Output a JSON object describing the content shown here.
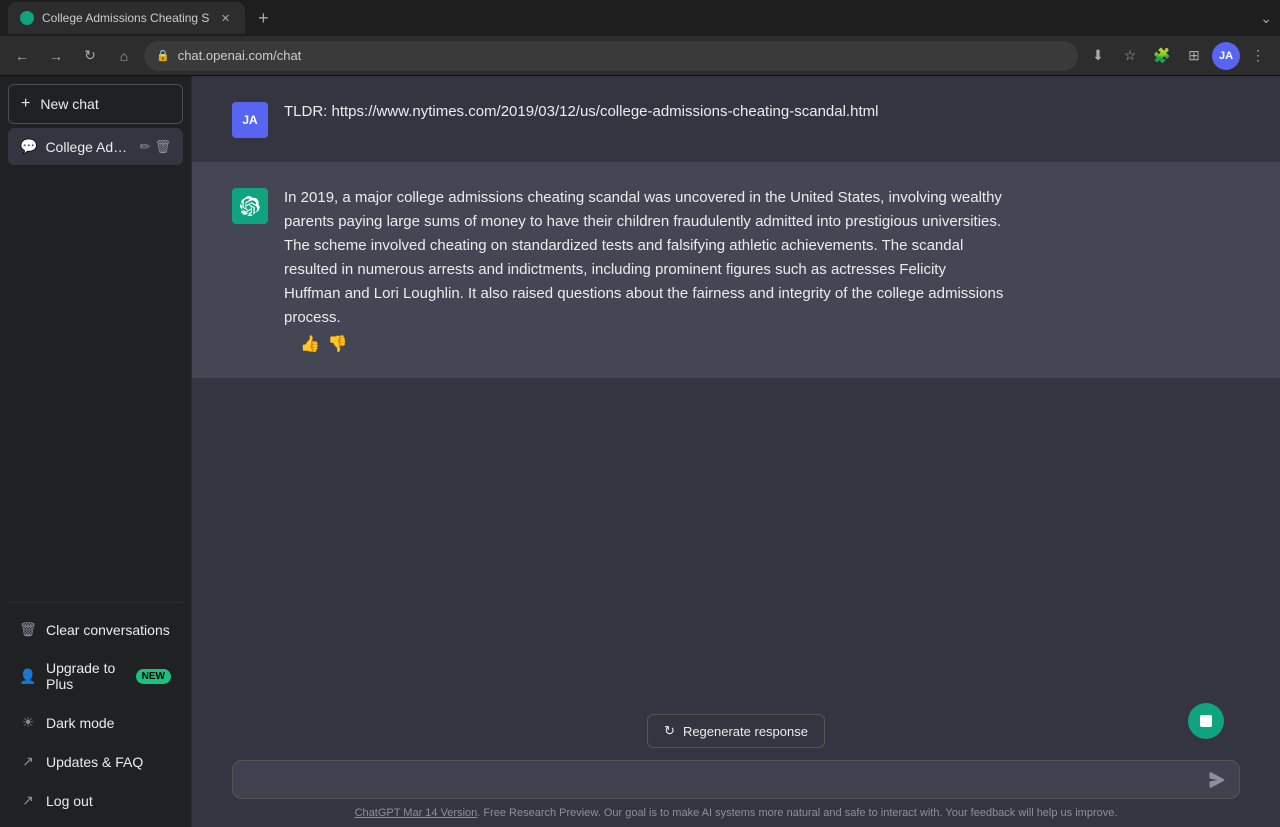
{
  "browser": {
    "tab_title": "College Admissions Cheating S",
    "url": "chat.openai.com/chat",
    "new_tab_label": "+"
  },
  "sidebar": {
    "new_chat_label": "New chat",
    "chat_items": [
      {
        "title": "College Admissions Ch"
      }
    ],
    "bottom_items": [
      {
        "label": "Clear conversations",
        "icon": "🗑"
      },
      {
        "label": "Upgrade to Plus",
        "icon": "👤",
        "badge": "NEW"
      },
      {
        "label": "Dark mode",
        "icon": "☀"
      },
      {
        "label": "Updates & FAQ",
        "icon": "↗"
      },
      {
        "label": "Log out",
        "icon": "↗"
      }
    ]
  },
  "messages": [
    {
      "role": "user",
      "avatar_initials": "JA",
      "content": "TLDR: https://www.nytimes.com/2019/03/12/us/college-admissions-cheating-scandal.html"
    },
    {
      "role": "ai",
      "content": "In 2019, a major college admissions cheating scandal was uncovered in the United States, involving wealthy parents paying large sums of money to have their children fraudulently admitted into prestigious universities. The scheme involved cheating on standardized tests and falsifying athletic achievements. The scandal resulted in numerous arrests and indictments, including prominent figures such as actresses Felicity Huffman and Lori Loughlin. It also raised questions about the fairness and integrity of the college admissions process."
    }
  ],
  "input": {
    "placeholder": ""
  },
  "footer": {
    "version_link": "ChatGPT Mar 14 Version",
    "description": ". Free Research Preview. Our goal is to make AI systems more natural and safe to interact with. Your feedback will help us improve."
  },
  "regen_button": "Regenerate response"
}
